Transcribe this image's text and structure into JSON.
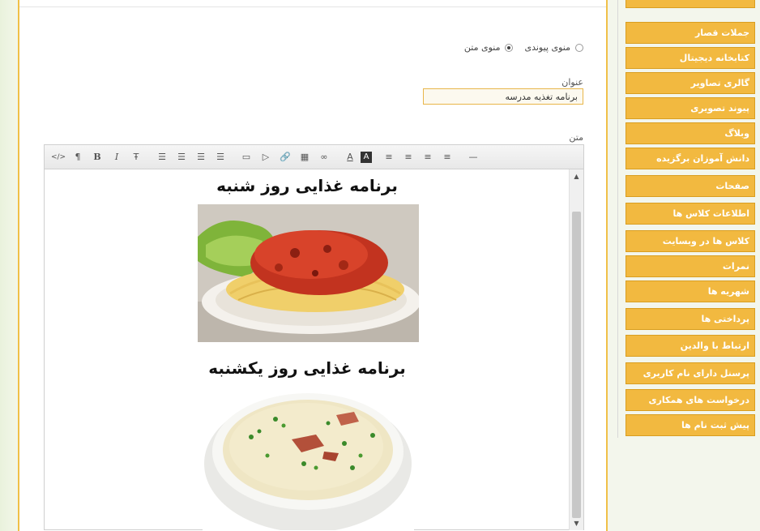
{
  "form": {
    "radio_link": "منوی پیوندی",
    "radio_text": "منوی متن",
    "title_label": "عنوان",
    "title_value": "برنامه تغذیه مدرسه",
    "body_label": "متن"
  },
  "editor": {
    "toolbar": [
      "</>",
      "¶",
      "B",
      "I",
      "Ŧ",
      "☰",
      "☰",
      "☰",
      "☰",
      "▭",
      "▷",
      "🔗",
      "▦",
      "∞",
      "A",
      "A",
      "≡",
      "≡",
      "≡",
      "≡",
      "—"
    ],
    "heading1": "برنامه غذایی روز شنبه",
    "heading2": "برنامه غذایی روز یکشنبه",
    "image1_alt": "spaghetti-image",
    "image2_alt": "soup-image"
  },
  "sidebar": {
    "items": [
      {
        "label": "جملات قصار"
      },
      {
        "label": "کتابخانه دیجیتال"
      },
      {
        "label": "گالری تصاویر"
      },
      {
        "label": "پیوند تصویری"
      },
      {
        "label": "وبلاگ"
      },
      {
        "label": "دانش آموزان برگزیده"
      },
      {
        "label": "صفحات"
      },
      {
        "label": "اطلاعات کلاس ها"
      },
      {
        "label": "کلاس ها در وبسایت"
      },
      {
        "label": "نمرات"
      },
      {
        "label": "شهریه ها"
      },
      {
        "label": "پرداختی ها"
      },
      {
        "label": "ارتباط با والدین"
      },
      {
        "label": "پرسنل دارای نام کاربری"
      },
      {
        "label": "درخواست های همکاری"
      },
      {
        "label": "پیش ثبت نام ها"
      }
    ]
  },
  "colors": {
    "accent": "#f2b940",
    "accent_border": "#d99e20"
  }
}
